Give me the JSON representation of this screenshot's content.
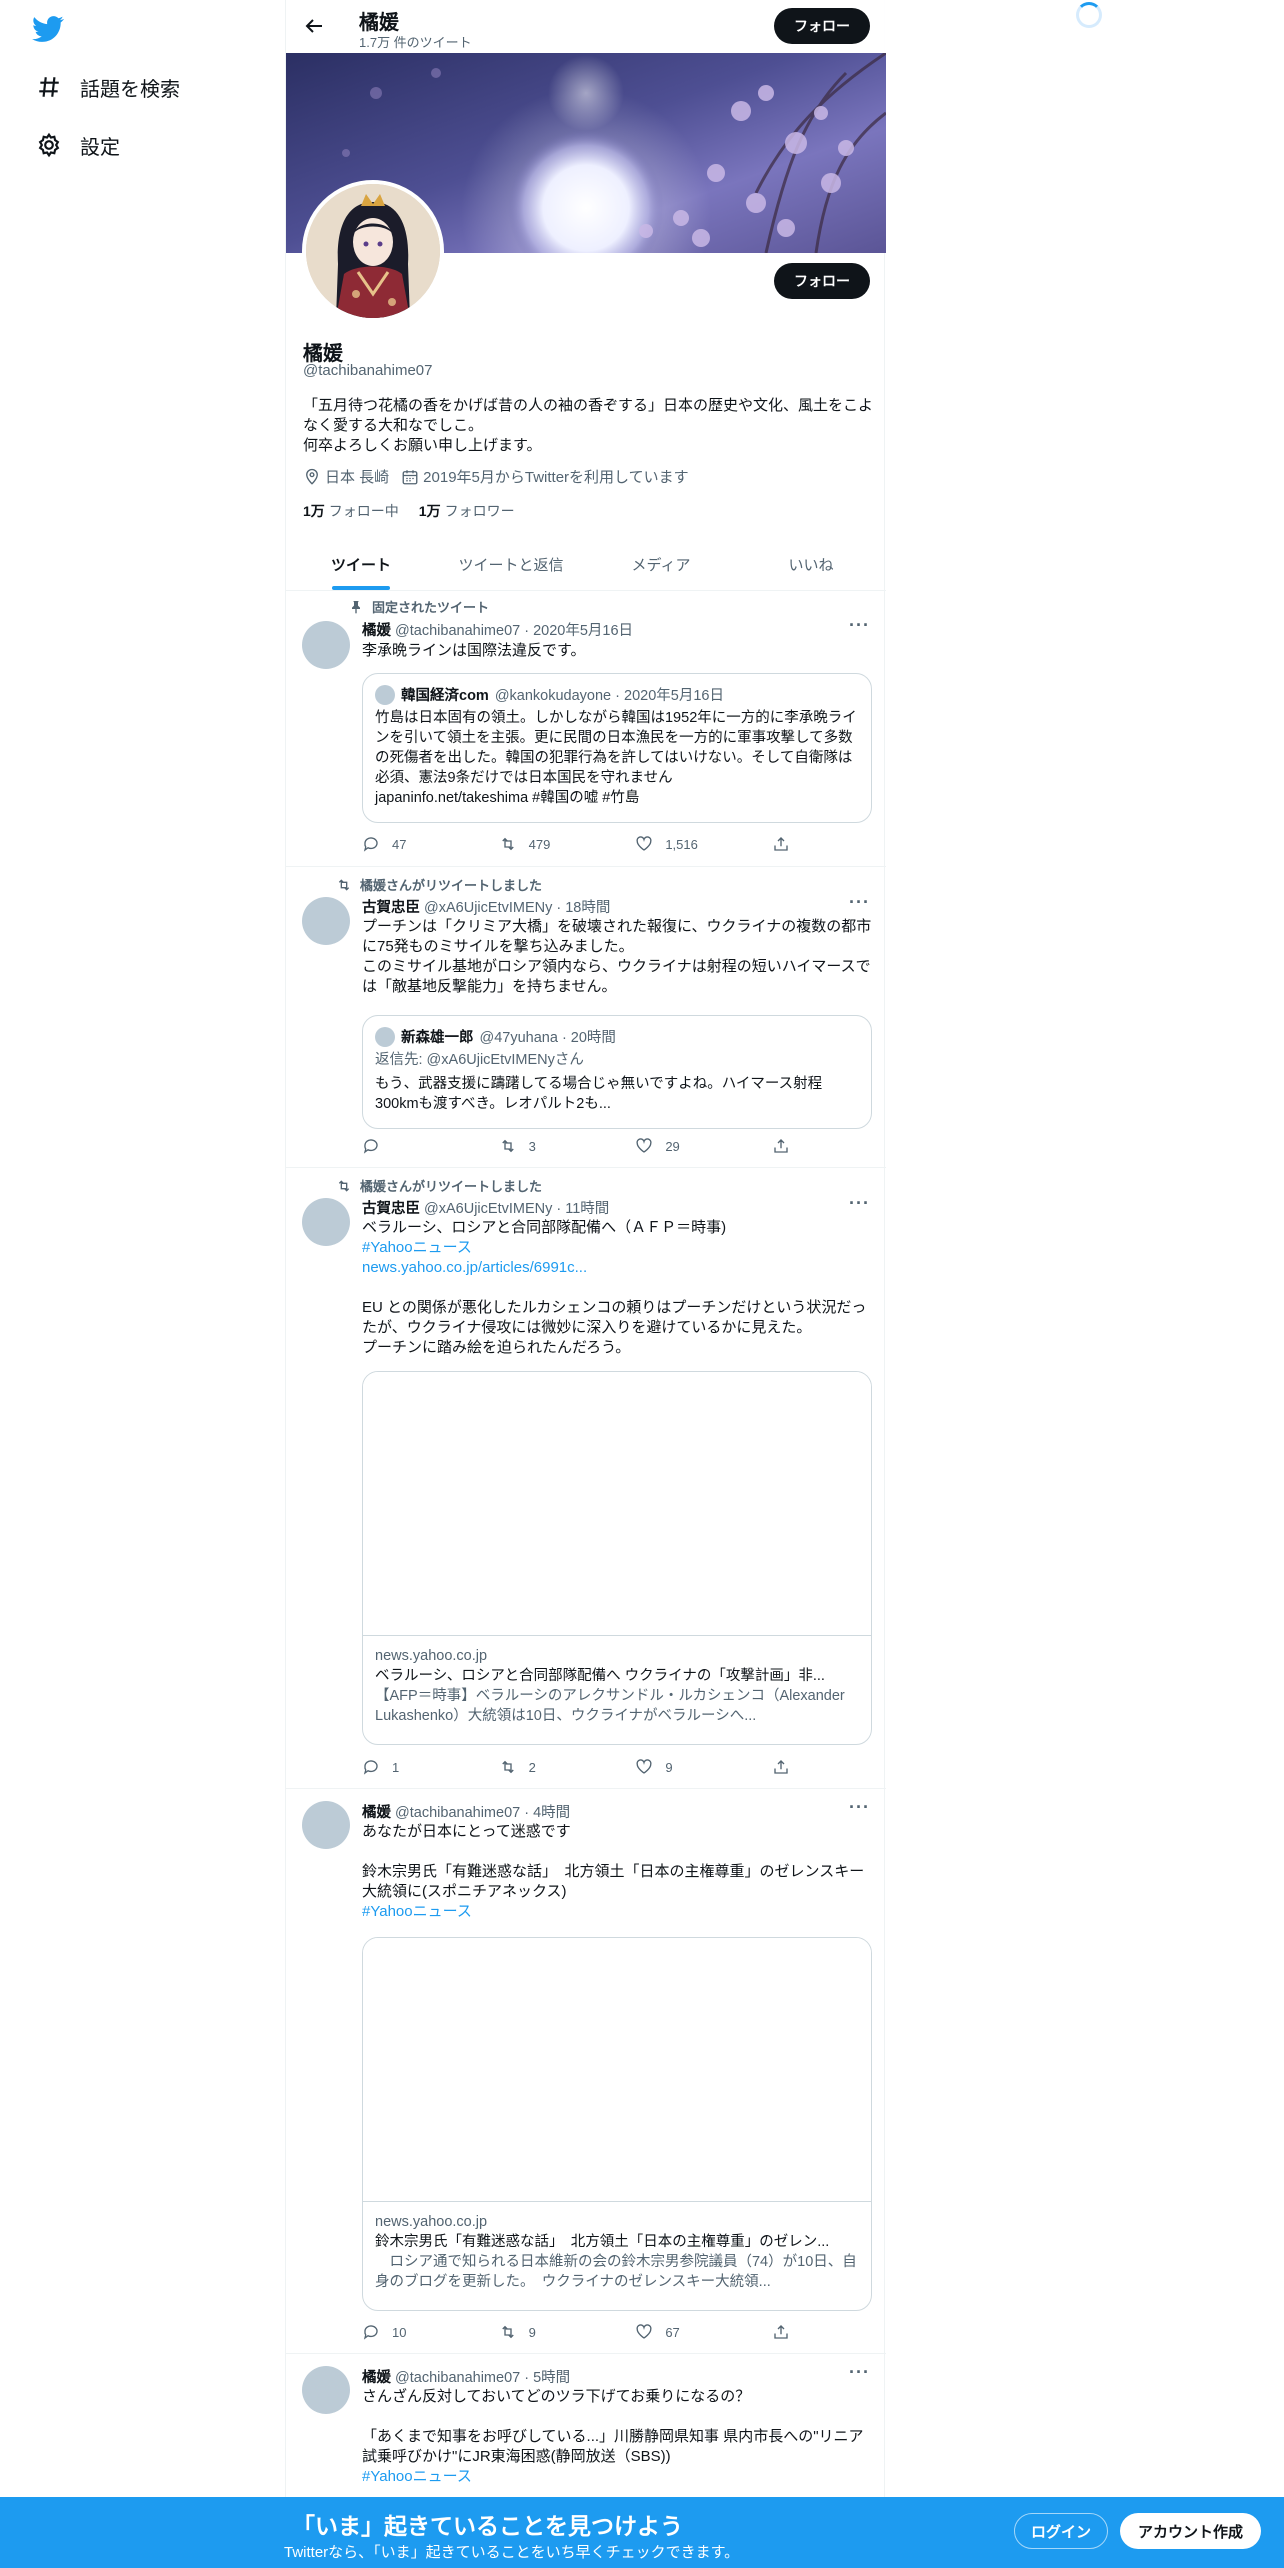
{
  "nav": {
    "explore_label": "話題を検索",
    "settings_label": "設定"
  },
  "header": {
    "title": "橘媛",
    "subtitle": "1.7万 件のツイート",
    "follow_label": "フォロー"
  },
  "profile": {
    "follow_label": "フォロー",
    "name": "橘媛",
    "handle": "@tachibanahime07",
    "bio": "「五月待つ花橘の香をかげば昔の人の袖の香ぞする」日本の歴史や文化、風土をこよなく愛する大和なでしこ。\n何卒よろしくお願い申し上げます。",
    "location": "日本 長崎",
    "joined": "2019年5月からTwitterを利用しています",
    "following_count": "1万",
    "following_label": "フォロー中",
    "followers_count": "1万",
    "followers_label": "フォロワー"
  },
  "tabs": [
    "ツイート",
    "ツイートと返信",
    "メディア",
    "いいね"
  ],
  "tweets": [
    {
      "context": "固定されたツイート",
      "name": "橘媛",
      "handle_time": "@tachibanahime07 · 2020年5月16日",
      "text": "李承晩ラインは国際法違反です。",
      "quote_name": "韓国経済com",
      "quote_handle_time": "@kankokudayone · 2020年5月16日",
      "quote_text": "竹島は日本固有の領土。しかしながら韓国は1952年に一方的に李承晩ラインを引いて領土を主張。更に民間の日本漁民を一方的に軍事攻撃して多数の死傷者を出した。韓国の犯罪行為を許してはいけない。そして自衛隊は必須、憲法9条だけでは日本国民を守れません\njapaninfo.net/takeshima #韓国の嘘 #竹島",
      "replies": "47",
      "retweets": "479",
      "likes": "1,516"
    },
    {
      "context": "橘媛さんがリツイートしました",
      "name": "古賀忠臣",
      "handle_time": "@xA6UjicEtvIMENy · 18時間",
      "text": "プーチンは「クリミア大橋」を破壊された報復に、ウクライナの複数の都市に75発ものミサイルを撃ち込みました。\nこのミサイル基地がロシア領内なら、ウクライナは射程の短いハイマースでは「敵基地反撃能力」を持ちません。",
      "quote_name": "新森雄一郎",
      "quote_handle_time": "@47yuhana · 20時間",
      "quote_reply": "返信先: @xA6UjicEtvIMENyさん",
      "quote_text": "もう、武器支援に躊躇してる場合じゃ無いですよね。ハイマース射程300kmも渡すべき。レオパルト2も...",
      "replies": "",
      "retweets": "3",
      "likes": "29"
    },
    {
      "context": "橘媛さんがリツイートしました",
      "name": "古賀忠臣",
      "handle_time": "@xA6UjicEtvIMENy · 11時間",
      "text_a": "ベラルーシ、ロシアと合同部隊配備へ（ＡＦＰ＝時事)",
      "text_link1": "#Yahooニュース",
      "text_link2": "news.yahoo.co.jp/articles/6991c...",
      "text_b": "EU との関係が悪化したルカシェンコの頼りはプーチンだけという状況だったが、ウクライナ侵攻には微妙に深入りを避けているかに見えた。\nプーチンに踏み絵を迫られたんだろう。",
      "card_domain": "news.yahoo.co.jp",
      "card_title": "ベラルーシ、ロシアと合同部隊配備へ ウクライナの「攻撃計画」非...",
      "card_desc": "【AFP＝時事】ベラルーシのアレクサンドル・ルカシェンコ（Alexander Lukashenko）大統領は10日、ウクライナがベラルーシへ...",
      "replies": "1",
      "retweets": "2",
      "likes": "9"
    },
    {
      "name": "橘媛",
      "handle_time": "@tachibanahime07 · 4時間",
      "text_a": "あなたが日本にとって迷惑です\n\n鈴木宗男氏「有難迷惑な話」　北方領土「日本の主権尊重」のゼレンスキー大統領に(スポニチアネックス)",
      "text_link1": "#Yahooニュース",
      "card_domain": "news.yahoo.co.jp",
      "card_title": "鈴木宗男氏「有難迷惑な話」　北方領土「日本の主権尊重」のゼレン...",
      "card_desc": "　ロシア通で知られる日本維新の会の鈴木宗男参院議員（74）が10日、自身のブログを更新した。　ウクライナのゼレンスキー大統領...",
      "replies": "10",
      "retweets": "9",
      "likes": "67"
    },
    {
      "name": "橘媛",
      "handle_time": "@tachibanahime07 · 5時間",
      "text_a": "さんざん反対しておいてどのツラ下げてお乗りになるの？\n\n「あくまで知事をお呼びしている...」川勝静岡県知事 県内市長への\"リニア試乗呼びかけ\"にJR東海困惑(静岡放送（SBS))",
      "text_link1": "#Yahooニュース"
    }
  ],
  "bottom": {
    "title": "「いま」起きていることを見つけよう",
    "subtitle": "Twitterなら、「いま」起きていることをいち早くチェックできます。",
    "login_label": "ログイン",
    "signup_label": "アカウント作成"
  },
  "colors": {
    "accent": "#1d9bf0",
    "text": "#0f1419",
    "muted": "#536471"
  }
}
